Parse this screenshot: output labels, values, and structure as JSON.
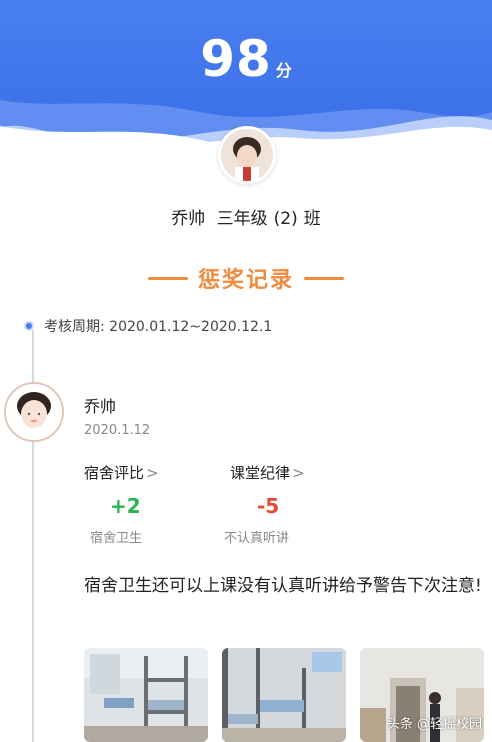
{
  "score": {
    "value": "98",
    "unit": "分"
  },
  "student": {
    "name": "乔帅",
    "grade": "三年级",
    "class_no": "(2)",
    "class_suffix": "班"
  },
  "section_title": "惩奖记录",
  "period": {
    "text": "考核周期: 2020.01.12~2020.12.1"
  },
  "record": {
    "name": "乔帅",
    "date": "2020.1.12",
    "categories": [
      {
        "label": "宿舍评比",
        "chevron": ">",
        "value": "+2",
        "sub": "宿舍卫生",
        "color": "#2bb24c"
      },
      {
        "label": "课堂纪律",
        "chevron": ">",
        "value": "-5",
        "sub": "不认真听讲",
        "color": "#e84a3c"
      }
    ],
    "comment": "宿舍卫生还可以上课没有认真听讲给予警告下次注意!"
  },
  "watermark": "头条 @轻摇校园",
  "colors": {
    "header_blue": "#3a73ec",
    "accent_orange": "#f08a3c",
    "plus_green": "#2bb24c",
    "minus_red": "#e84a3c"
  }
}
